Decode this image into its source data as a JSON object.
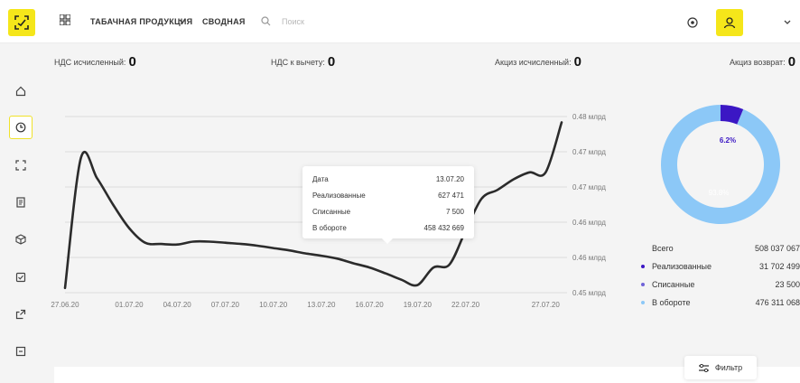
{
  "header": {
    "product_label": "ТАБАЧНАЯ ПРОДУКЦИЯ",
    "summary_tab": "СВОДНАЯ",
    "search_placeholder": "Поиск"
  },
  "kpis": [
    {
      "label": "НДС исчисленный:",
      "value": "0"
    },
    {
      "label": "НДС к вычету:",
      "value": "0"
    },
    {
      "label": "Акциз исчисленный:",
      "value": "0"
    },
    {
      "label": "Акциз возврат:",
      "value": "0"
    }
  ],
  "tooltip": {
    "rows": [
      {
        "label": "Дата",
        "value": "13.07.20"
      },
      {
        "label": "Реализованные",
        "value": "627 471"
      },
      {
        "label": "Списанные",
        "value": "7 500"
      },
      {
        "label": "В обороте",
        "value": "458 432 669"
      }
    ]
  },
  "chart_data": [
    {
      "type": "line",
      "x": [
        "27.06.20",
        "28.06.20",
        "29.06.20",
        "30.06.20",
        "01.07.20",
        "02.07.20",
        "03.07.20",
        "04.07.20",
        "05.07.20",
        "06.07.20",
        "07.07.20",
        "08.07.20",
        "09.07.20",
        "10.07.20",
        "11.07.20",
        "12.07.20",
        "13.07.20",
        "14.07.20",
        "15.07.20",
        "16.07.20",
        "17.07.20",
        "18.07.20",
        "19.07.20",
        "20.07.20",
        "21.07.20",
        "22.07.20",
        "23.07.20",
        "24.07.20",
        "25.07.20",
        "26.07.20",
        "27.07.20",
        "28.07.20"
      ],
      "y_units": "млрд",
      "series": [
        {
          "values": [
            0.4508,
            0.473,
            0.4695,
            0.465,
            0.461,
            0.4585,
            0.4583,
            0.4582,
            0.4587,
            0.4587,
            0.4585,
            0.4583,
            0.458,
            0.4576,
            0.4572,
            0.4567,
            0.4563,
            0.4558,
            0.455,
            0.4543,
            0.4533,
            0.4522,
            0.4513,
            0.4543,
            0.4548,
            0.4605,
            0.466,
            0.4675,
            0.4693,
            0.4705,
            0.4705,
            0.479
          ]
        }
      ],
      "x_tick_labels": [
        "27.06.20",
        "01.07.20",
        "04.07.20",
        "07.07.20",
        "10.07.20",
        "13.07.20",
        "16.07.20",
        "19.07.20",
        "22.07.20",
        "27.07.20"
      ],
      "y_tick_labels": [
        "0.48 млрд",
        "0.47 млрд",
        "0.47 млрд",
        "0.46 млрд",
        "0.46 млрд",
        "0.45 млрд"
      ],
      "ylim": [
        0.45,
        0.48
      ],
      "grid": true
    },
    {
      "type": "pie",
      "categories": [
        "Реализованные",
        "Списанные",
        "В обороте"
      ],
      "values": [
        31702499,
        23500,
        476311068
      ],
      "slice_labels": [
        "6.2%",
        "",
        "93.8%"
      ],
      "colors": [
        "#3b17c4",
        "#6f63d8",
        "#8cc8f7"
      ],
      "total_label": "Всего",
      "total_value": "508 037 067",
      "value_labels": [
        "31 702 499",
        "23 500",
        "476 311 068"
      ]
    }
  ],
  "filter": {
    "label": "Фильтр"
  },
  "icons": {
    "logo": "scan-logo-icon",
    "grid": "apps-grid-icon",
    "chevron": "chevron-down-icon",
    "search": "search-icon",
    "notify": "notification-icon",
    "user": "user-icon",
    "sidebar": [
      "home-icon",
      "dashboard-clock-icon",
      "scan-frame-icon",
      "document-icon",
      "box-icon",
      "checklist-icon",
      "export-icon",
      "receipt-icon"
    ],
    "filter": "filter-sliders-icon"
  }
}
